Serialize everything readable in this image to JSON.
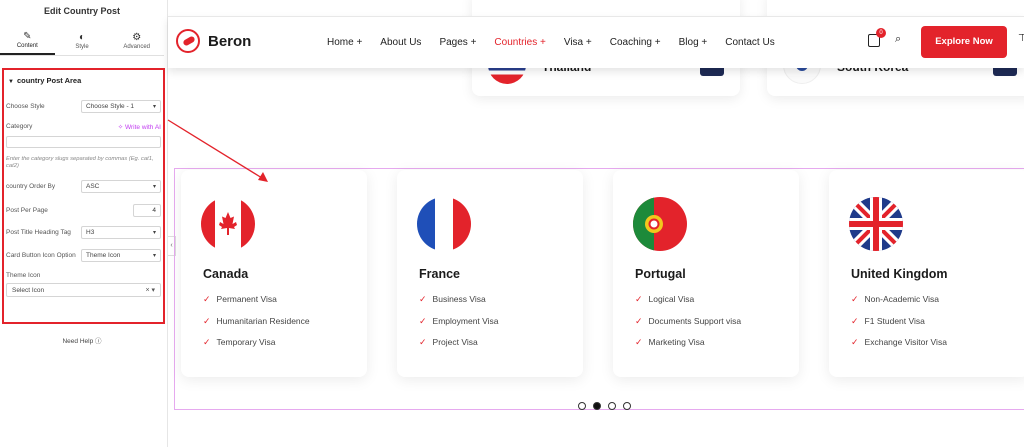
{
  "editor": {
    "title": "Edit Country Post",
    "tabs": [
      {
        "label": "Content",
        "icon": "pencil-icon"
      },
      {
        "label": "Style",
        "icon": "half-circle-icon"
      },
      {
        "label": "Advanced",
        "icon": "gear-icon"
      }
    ],
    "section_title": "country Post Area",
    "fields": {
      "choose_style_label": "Choose Style",
      "choose_style_value": "Choose Style - 1",
      "category_label": "Category",
      "write_ai": "Write with AI",
      "category_hint": "Enter the category slugs separated by commas (Eg. cat1, cat2)",
      "order_by_label": "country Order By",
      "order_by_value": "ASC",
      "per_page_label": "Post Per Page",
      "per_page_value": "4",
      "heading_tag_label": "Post Title Heading Tag",
      "heading_tag_value": "H3",
      "card_button_label": "Card Button Icon Option",
      "card_button_value": "Theme Icon",
      "theme_icon_label": "Theme Icon",
      "theme_icon_value": "Select Icon"
    },
    "help": "Need Help"
  },
  "site": {
    "brand": "Beron",
    "nav": [
      "Home +",
      "About Us",
      "Pages +",
      "Countries +",
      "Visa +",
      "Coaching +",
      "Blog +",
      "Contact Us"
    ],
    "active_nav": "Countries +",
    "cart_count": "0",
    "cta": "Explore Now",
    "accent": "#e3232b",
    "top_cards": [
      "Thailand",
      "South Korea"
    ]
  },
  "countries": [
    {
      "name": "Canada",
      "items": [
        "Permanent Visa",
        "Humanitarian Residence",
        "Temporary Visa"
      ]
    },
    {
      "name": "France",
      "items": [
        "Business Visa",
        "Employment Visa",
        "Project Visa"
      ]
    },
    {
      "name": "Portugal",
      "items": [
        "Logical Visa",
        "Documents Support visa",
        "Marketing Visa"
      ]
    },
    {
      "name": "United Kingdom",
      "items": [
        "Non-Academic Visa",
        "F1 Student Visa",
        "Exchange Visitor Visa"
      ]
    }
  ],
  "slider": {
    "active_dot": 2,
    "dots": 4
  }
}
